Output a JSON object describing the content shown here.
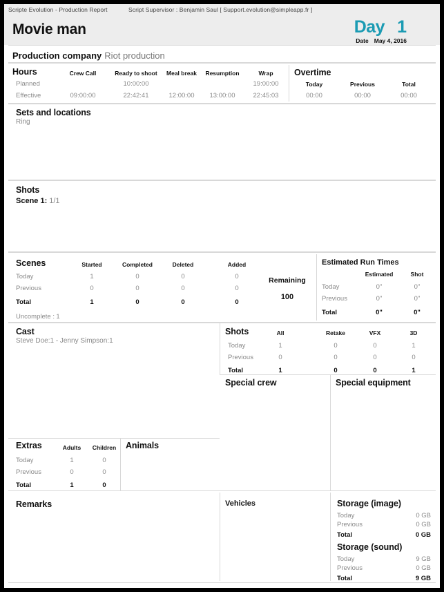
{
  "meta": {
    "app_line": "Scripte Evolution - Production Report",
    "supervisor_line": "Script Supervisor :  Benjamin Saul [ Support.evolution@simpleapp.fr ]"
  },
  "header": {
    "movie_title": "Movie man",
    "day_label": "Day",
    "day_number": "1",
    "date_label": "Date",
    "date_value": "May 4, 2016",
    "accent_color": "#1b9bb3"
  },
  "production_company": {
    "label": "Production company",
    "value": "Riot production"
  },
  "hours": {
    "title": "Hours",
    "columns": [
      "Crew Call",
      "Ready to shoot",
      "Meal break",
      "Resumption",
      "Wrap"
    ],
    "rows": [
      {
        "label": "Planned",
        "values": [
          "",
          "10:00:00",
          "",
          "",
          "19:00:00"
        ]
      },
      {
        "label": "Effective",
        "values": [
          "09:00:00",
          "22:42:41",
          "12:00:00",
          "13:00:00",
          "22:45:03"
        ]
      }
    ]
  },
  "overtime": {
    "title": "Overtime",
    "columns": [
      "Today",
      "Previous",
      "Total"
    ],
    "values": [
      "00:00",
      "00:00",
      "00:00"
    ]
  },
  "sets_and_locations": {
    "title": "Sets and locations",
    "value": "Ring"
  },
  "shots_list": {
    "title": "Shots",
    "scene_label": "Scene 1:",
    "scene_value": "1/1"
  },
  "scenes": {
    "title": "Scenes",
    "columns": [
      "Started",
      "Completed",
      "Deleted",
      "Added"
    ],
    "rows": [
      {
        "label": "Today",
        "values": [
          "1",
          "0",
          "0",
          "0"
        ]
      },
      {
        "label": "Previous",
        "values": [
          "0",
          "0",
          "0",
          "0"
        ]
      },
      {
        "label": "Total",
        "values": [
          "1",
          "0",
          "0",
          "0"
        ]
      }
    ],
    "uncomplete_label": "Uncomplete :",
    "uncomplete_value": "1",
    "remaining_label": "Remaining",
    "remaining_value": "100"
  },
  "estimated_run_times": {
    "title": "Estimated Run Times",
    "columns": [
      "Estimated",
      "Shot"
    ],
    "rows": [
      {
        "label": "Today",
        "values": [
          "0\"",
          "0\""
        ]
      },
      {
        "label": "Previous",
        "values": [
          "0\"",
          "0\""
        ]
      },
      {
        "label": "Total",
        "values": [
          "0\"",
          "0\""
        ]
      }
    ]
  },
  "cast": {
    "title": "Cast",
    "value": "Steve Doe:1 - Jenny Simpson:1"
  },
  "shots_table": {
    "title": "Shots",
    "columns": [
      "All",
      "Retake",
      "VFX",
      "3D"
    ],
    "rows": [
      {
        "label": "Today",
        "values": [
          "1",
          "0",
          "0",
          "1"
        ]
      },
      {
        "label": "Previous",
        "values": [
          "0",
          "0",
          "0",
          "0"
        ]
      },
      {
        "label": "Total",
        "values": [
          "1",
          "0",
          "0",
          "1"
        ]
      }
    ]
  },
  "special_crew": {
    "title": "Special crew",
    "value": ""
  },
  "special_equipment": {
    "title": "Special equipment",
    "value": ""
  },
  "extras": {
    "title": "Extras",
    "columns": [
      "Adults",
      "Children"
    ],
    "rows": [
      {
        "label": "Today",
        "values": [
          "1",
          "0"
        ]
      },
      {
        "label": "Previous",
        "values": [
          "0",
          "0"
        ]
      },
      {
        "label": "Total",
        "values": [
          "1",
          "0"
        ]
      }
    ]
  },
  "animals": {
    "title": "Animals",
    "value": ""
  },
  "remarks": {
    "title": "Remarks",
    "value": ""
  },
  "vehicles": {
    "title": "Vehicles",
    "value": ""
  },
  "storage_image": {
    "title": "Storage (image)",
    "rows": [
      {
        "label": "Today",
        "value": "0 GB"
      },
      {
        "label": "Previous",
        "value": "0 GB"
      },
      {
        "label": "Total",
        "value": "0 GB"
      }
    ]
  },
  "storage_sound": {
    "title": "Storage (sound)",
    "rows": [
      {
        "label": "Today",
        "value": "9 GB"
      },
      {
        "label": "Previous",
        "value": "0 GB"
      },
      {
        "label": "Total",
        "value": "9 GB"
      }
    ]
  }
}
